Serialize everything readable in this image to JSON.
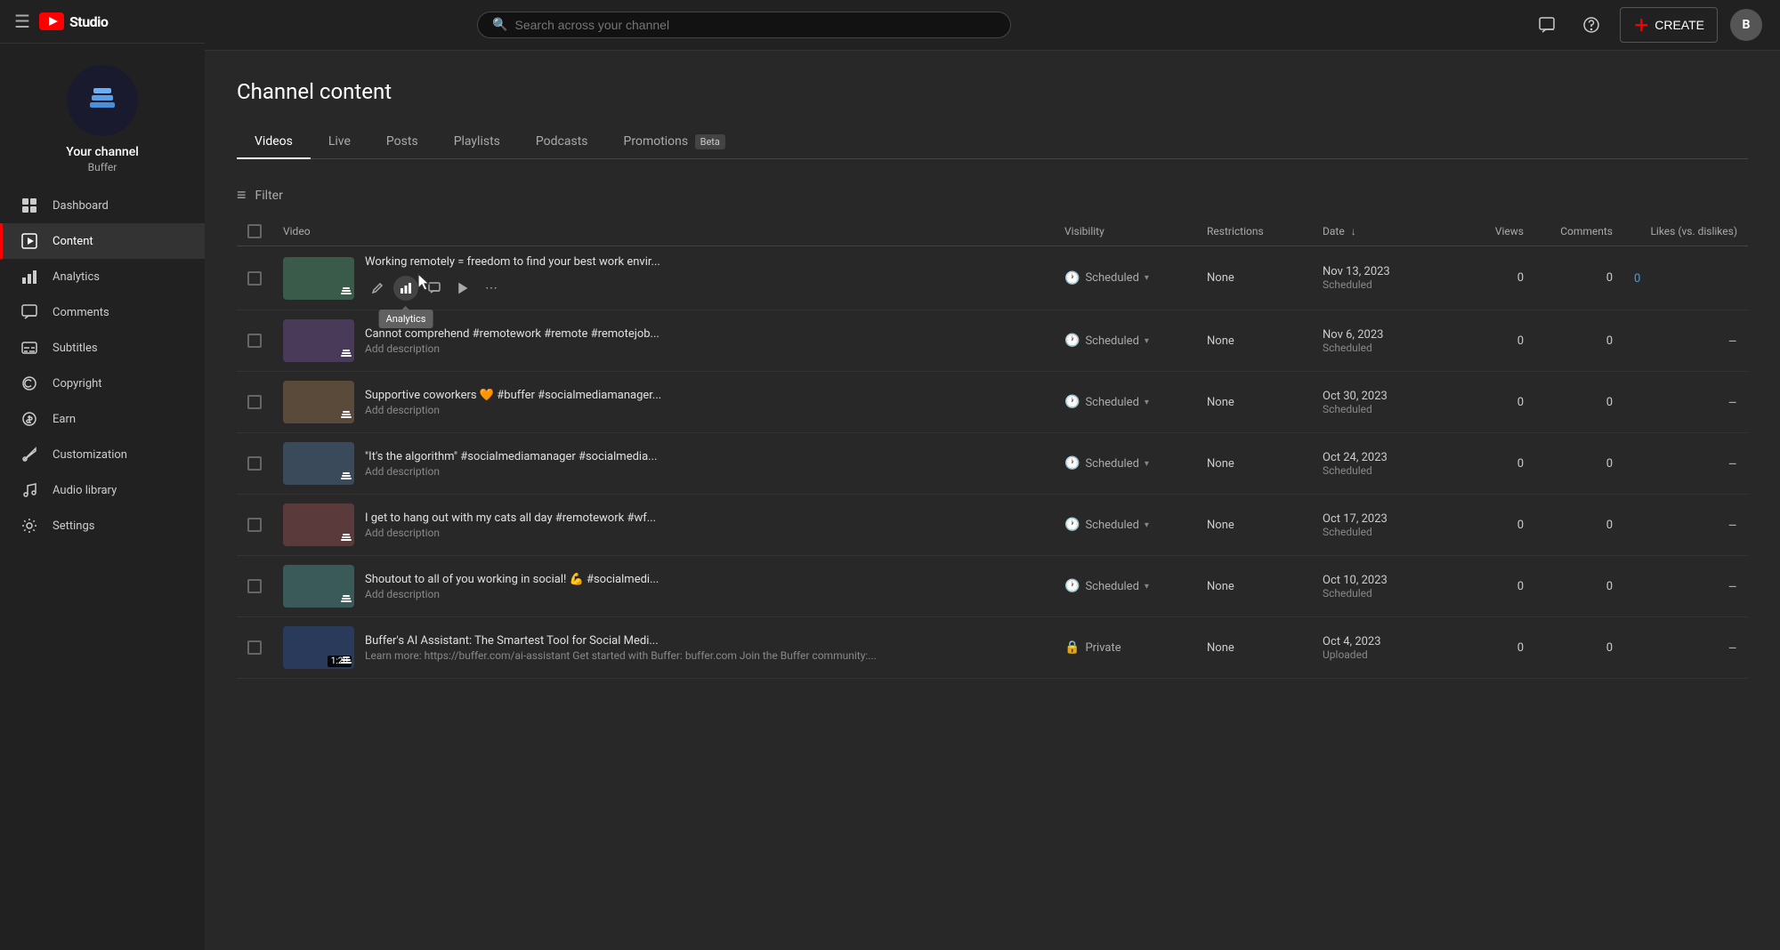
{
  "app": {
    "title": "YouTube Studio",
    "logo_text": "Studio"
  },
  "topbar": {
    "search_placeholder": "Search across your channel",
    "create_label": "CREATE"
  },
  "sidebar": {
    "channel_name": "Your channel",
    "channel_handle": "Buffer",
    "nav_items": [
      {
        "id": "dashboard",
        "label": "Dashboard",
        "icon": "grid"
      },
      {
        "id": "content",
        "label": "Content",
        "icon": "play",
        "active": true
      },
      {
        "id": "analytics",
        "label": "Analytics",
        "icon": "chart"
      },
      {
        "id": "comments",
        "label": "Comments",
        "icon": "comment"
      },
      {
        "id": "subtitles",
        "label": "Subtitles",
        "icon": "subtitle"
      },
      {
        "id": "copyright",
        "label": "Copyright",
        "icon": "copyright"
      },
      {
        "id": "earn",
        "label": "Earn",
        "icon": "dollar"
      },
      {
        "id": "customization",
        "label": "Customization",
        "icon": "brush"
      },
      {
        "id": "audio-library",
        "label": "Audio library",
        "icon": "music"
      },
      {
        "id": "settings",
        "label": "Settings",
        "icon": "gear"
      }
    ]
  },
  "content": {
    "page_title": "Channel content",
    "tabs": [
      {
        "id": "videos",
        "label": "Videos",
        "active": true
      },
      {
        "id": "live",
        "label": "Live",
        "active": false
      },
      {
        "id": "posts",
        "label": "Posts",
        "active": false
      },
      {
        "id": "playlists",
        "label": "Playlists",
        "active": false
      },
      {
        "id": "podcasts",
        "label": "Podcasts",
        "active": false
      },
      {
        "id": "promotions",
        "label": "Promotions",
        "active": false,
        "badge": "Beta"
      }
    ],
    "filter_label": "Filter",
    "table": {
      "columns": [
        {
          "id": "check",
          "label": ""
        },
        {
          "id": "video",
          "label": "Video"
        },
        {
          "id": "visibility",
          "label": "Visibility"
        },
        {
          "id": "restrictions",
          "label": "Restrictions"
        },
        {
          "id": "date",
          "label": "Date"
        },
        {
          "id": "views",
          "label": "Views"
        },
        {
          "id": "comments",
          "label": "Comments"
        },
        {
          "id": "likes",
          "label": "Likes (vs. dislikes)"
        }
      ],
      "rows": [
        {
          "id": 1,
          "title": "Working remotely = freedom to find your best work envir...",
          "description": "",
          "visibility": "Scheduled",
          "visibility_type": "clock",
          "restrictions": "None",
          "date_main": "Nov 13, 2023",
          "date_sub": "Scheduled",
          "views": "0",
          "comments": "0",
          "likes": "0",
          "likes_type": "link",
          "show_actions": true,
          "thumb_color": "#3a5a4a"
        },
        {
          "id": 2,
          "title": "Cannot comprehend #remotework #remote #remotejob...",
          "description": "Add description",
          "visibility": "Scheduled",
          "visibility_type": "clock",
          "restrictions": "None",
          "date_main": "Nov 6, 2023",
          "date_sub": "Scheduled",
          "views": "0",
          "comments": "0",
          "likes": "–",
          "likes_type": "dash",
          "show_actions": false,
          "thumb_color": "#4a3a5a"
        },
        {
          "id": 3,
          "title": "Supportive coworkers 🧡 #buffer #socialmediamanager...",
          "description": "Add description",
          "visibility": "Scheduled",
          "visibility_type": "clock",
          "restrictions": "None",
          "date_main": "Oct 30, 2023",
          "date_sub": "Scheduled",
          "views": "0",
          "comments": "0",
          "likes": "–",
          "likes_type": "dash",
          "show_actions": false,
          "thumb_color": "#5a4a3a"
        },
        {
          "id": 4,
          "title": "\"It's the algorithm\" #socialmediamanager #socialmedia...",
          "description": "Add description",
          "visibility": "Scheduled",
          "visibility_type": "clock",
          "restrictions": "None",
          "date_main": "Oct 24, 2023",
          "date_sub": "Scheduled",
          "views": "0",
          "comments": "0",
          "likes": "–",
          "likes_type": "dash",
          "show_actions": false,
          "thumb_color": "#3a4a5a"
        },
        {
          "id": 5,
          "title": "I get to hang out with my cats all day #remotework #wf...",
          "description": "Add description",
          "visibility": "Scheduled",
          "visibility_type": "clock",
          "restrictions": "None",
          "date_main": "Oct 17, 2023",
          "date_sub": "Scheduled",
          "views": "0",
          "comments": "0",
          "likes": "–",
          "likes_type": "dash",
          "show_actions": false,
          "thumb_color": "#5a3a3a"
        },
        {
          "id": 6,
          "title": "Shoutout to all of you working in social! 💪 #socialmedi...",
          "description": "Add description",
          "visibility": "Scheduled",
          "visibility_type": "clock",
          "restrictions": "None",
          "date_main": "Oct 10, 2023",
          "date_sub": "Scheduled",
          "views": "0",
          "comments": "0",
          "likes": "–",
          "likes_type": "dash",
          "show_actions": false,
          "thumb_color": "#3a5a5a"
        },
        {
          "id": 7,
          "title": "Buffer's AI Assistant: The Smartest Tool for Social Medi...",
          "description": "Learn more: https://buffer.com/ai-assistant Get started with Buffer: buffer.com Join the Buffer community:...",
          "visibility": "Private",
          "visibility_type": "private",
          "restrictions": "None",
          "date_main": "Oct 4, 2023",
          "date_sub": "Uploaded",
          "views": "0",
          "comments": "0",
          "likes": "–",
          "likes_type": "dash",
          "show_actions": false,
          "thumb_color": "#2a3a5a",
          "duration": "1:28"
        }
      ]
    }
  },
  "tooltip": {
    "analytics_label": "Analytics"
  }
}
